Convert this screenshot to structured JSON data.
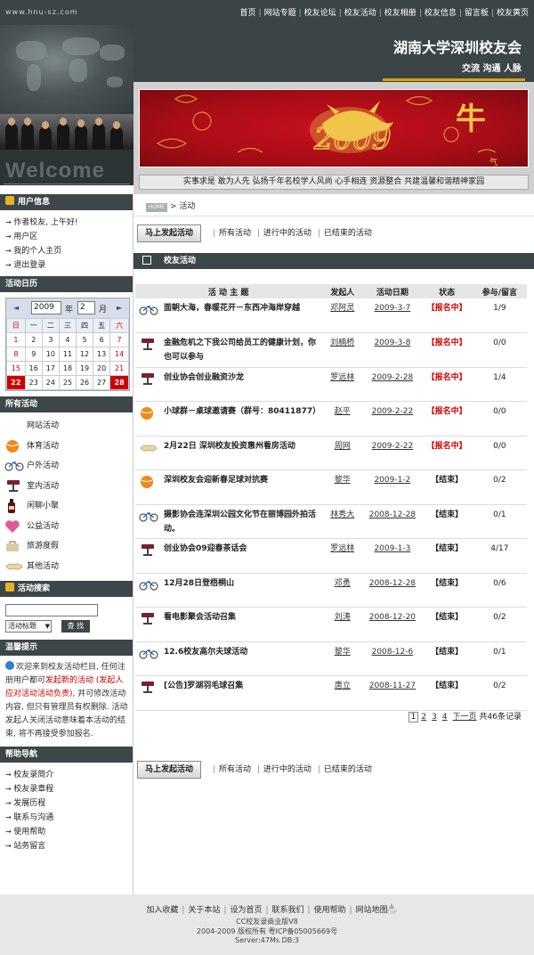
{
  "site": {
    "url": "www.hnu-sz.com",
    "title": "湖南大学深圳校友会",
    "slogan": "交流 沟通 人脉",
    "welcome": "Welcome"
  },
  "topnav": [
    "首页",
    "网站专题",
    "校友论坛",
    "校友活动",
    "校友相册",
    "校友信息",
    "留言板",
    "校友黄页"
  ],
  "banner": {
    "caption": "实事求是  敢为人先  弘扬千年名校学人风尚    心手相连  资源整合  共建温馨和谐精神家园",
    "big_year": "2009",
    "big_char": "牛",
    "small_text": "气冲天"
  },
  "user_info": {
    "heading": "用户信息",
    "items": [
      "作者校友, 上午好!",
      "用户区",
      "我的个人主页",
      "退出登录"
    ]
  },
  "calendar": {
    "heading": "活动日历",
    "year": "2009",
    "year_label": "年",
    "month": "2",
    "month_label": "月",
    "weekdays": [
      "日",
      "一",
      "二",
      "三",
      "四",
      "五",
      "六"
    ],
    "weeks": [
      [
        "1",
        "2",
        "3",
        "4",
        "5",
        "6",
        "7"
      ],
      [
        "8",
        "9",
        "10",
        "11",
        "12",
        "13",
        "14"
      ],
      [
        "15",
        "16",
        "17",
        "18",
        "19",
        "20",
        "21"
      ],
      [
        "22",
        "23",
        "24",
        "25",
        "26",
        "27",
        "28"
      ]
    ],
    "highlighted": [
      "22",
      "28"
    ]
  },
  "all_activities": {
    "heading": "所有活动",
    "title": "网站活动",
    "categories": [
      {
        "label": "体育活动",
        "icon": "ball-icon"
      },
      {
        "label": "户外活动",
        "icon": "bicycle-icon"
      },
      {
        "label": "室内活动",
        "icon": "projector-icon"
      },
      {
        "label": "闲聊小聚",
        "icon": "wine-icon"
      },
      {
        "label": "公益活动",
        "icon": "heart-icon"
      },
      {
        "label": "旅游度假",
        "icon": "travel-icon"
      },
      {
        "label": "其他活动",
        "icon": "handshake-icon"
      }
    ]
  },
  "activity_search": {
    "heading": "活动搜索",
    "input_value": "",
    "select_value": "活动标题",
    "button_label": "查 找"
  },
  "tips": {
    "heading": "温馨提示",
    "text_before": "欢迎来到校友活动栏目, 任何注册用户都可",
    "text_highlight": "发起新的活动 (发起人应对活动活动负责)",
    "text_after": ", 并可修改活动内容, 但只有管理员有权删除. 活动发起人关闭活动意味着本活动的结束, 将不再接受参加报名."
  },
  "help_nav": {
    "heading": "帮助导航",
    "items": [
      "校友录简介",
      "校友录章程",
      "发展历程",
      "联系与沟通",
      "使用帮助",
      "站务留言"
    ]
  },
  "breadcrumb": {
    "home": "HOME",
    "current": "活动"
  },
  "actionbar": {
    "launch_button": "马上发起活动",
    "filters": [
      "所有活动",
      "进行中的活动",
      "已结束的活动"
    ]
  },
  "section": {
    "title": "校友活动"
  },
  "table": {
    "headers": [
      "活 动 主 题",
      "发起人",
      "活动日期",
      "状态",
      "参与/留言"
    ],
    "rows": [
      {
        "title": "面朝大海，春暖花开－东西冲海岸穿越",
        "initiator": "邓阿灵",
        "date": "2009-3-7",
        "status": "【报名中】",
        "open": true,
        "count": "1/9",
        "icon": "bicycle-icon"
      },
      {
        "title": "金融危机之下我公司给员工的健康计划，你也可以参与",
        "initiator": "刘楠桥",
        "date": "2009-3-8",
        "status": "【报名中】",
        "open": true,
        "count": "0/0",
        "icon": "projector-icon"
      },
      {
        "title": "创业协会创业融资沙龙",
        "initiator": "罗远林",
        "date": "2009-2-28",
        "status": "【报名中】",
        "open": true,
        "count": "1/4",
        "icon": "projector-icon"
      },
      {
        "title": "小球群－桌球邀请赛（群号：80411877）",
        "initiator": "赵平",
        "date": "2009-2-22",
        "status": "【报名中】",
        "open": true,
        "count": "0/0",
        "icon": "ball-icon"
      },
      {
        "title": "2月22日 深圳校友投资惠州看房活动",
        "initiator": "周网",
        "date": "2009-2-22",
        "status": "【报名中】",
        "open": true,
        "count": "0/0",
        "icon": "handshake-icon"
      },
      {
        "title": "深圳校友会迎新春足球对抗赛",
        "initiator": "黎华",
        "date": "2009-1-2",
        "status": "【结束】",
        "open": false,
        "count": "0/2",
        "icon": "ball-icon"
      },
      {
        "title": "摄影协会连深圳公园文化节在丽博园外拍活动。",
        "initiator": "林秀大",
        "date": "2008-12-28",
        "status": "【结束】",
        "open": false,
        "count": "0/1",
        "icon": "bicycle-icon"
      },
      {
        "title": "创业协会09迎春茶话会",
        "initiator": "罗远林",
        "date": "2009-1-3",
        "status": "【结束】",
        "open": false,
        "count": "4/17",
        "icon": "projector-icon"
      },
      {
        "title": "12月28日登梧桐山",
        "initiator": "邓勇",
        "date": "2008-12-28",
        "status": "【结束】",
        "open": false,
        "count": "0/6",
        "icon": "bicycle-icon"
      },
      {
        "title": "看电影聚会活动召集",
        "initiator": "刘涛",
        "date": "2008-12-20",
        "status": "【结束】",
        "open": false,
        "count": "0/2",
        "icon": "projector-icon"
      },
      {
        "title": "12.6校友高尔夫球活动",
        "initiator": "黎华",
        "date": "2008-12-6",
        "status": "【结束】",
        "open": false,
        "count": "0/1",
        "icon": "bicycle-icon"
      },
      {
        "title": "[公告]罗湖羽毛球召集",
        "initiator": "唐立",
        "date": "2008-11-27",
        "status": "【结束】",
        "open": false,
        "count": "0/2",
        "icon": "projector-icon"
      }
    ]
  },
  "pager": {
    "pages": [
      "1",
      "2",
      "3",
      "4"
    ],
    "current": "1",
    "next": "下一页",
    "total": "共46条记录"
  },
  "footer": {
    "links": [
      "加入收藏",
      "关于本站",
      "设为首页",
      "联系我们",
      "使用帮助",
      "网站地图"
    ],
    "top": "TOP",
    "line1": "CC校友录商业版V8",
    "line2": "2004-2009 版权所有  粤ICP备05005669号",
    "line3": "Server:47Ms  DB:3"
  }
}
